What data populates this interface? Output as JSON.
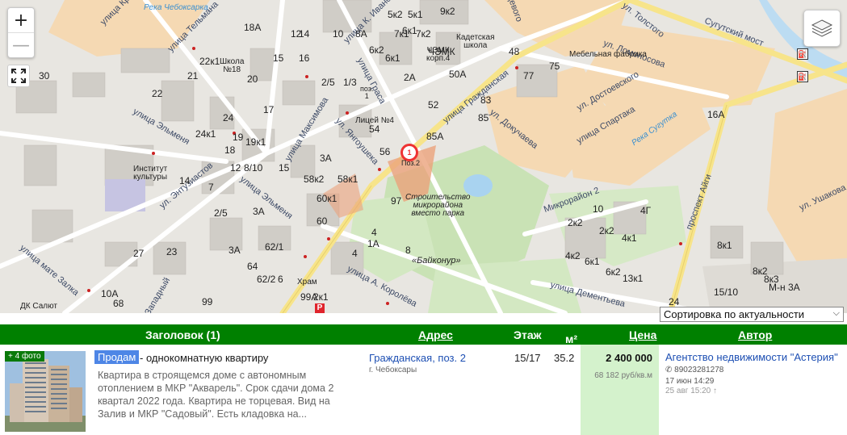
{
  "map": {
    "zoom_in": "+",
    "zoom_out": "—",
    "pin_number": "1",
    "pin_label": "Поз.2",
    "parking": "P",
    "gas": "⛽",
    "streets": {
      "s1": "улица Кр",
      "s2": "улица Тельмана",
      "s3": "улица К. Иванова",
      "s4": "улица Гладкова",
      "s5": "улица Граса",
      "s6": "улица Гражданская",
      "s7": "ул. Толстого",
      "s8": "ул. Ломоносова",
      "s9": "ул. Достоевского",
      "s10": "улица Спартака",
      "s11": "ул. Докучаева",
      "s12": "Сугутский мост",
      "s13": "улица Эльменя",
      "s14": "улица Максимова",
      "s15": "ул. Янгоушека",
      "s16": "ул. Энтузиастов",
      "s17": "улица Эльменя",
      "s18": "улица мате Залка",
      "s19": "Западный",
      "s20": "улица А. Королёва",
      "s21": "улица Дементьева",
      "s22": "Микрорайон 2",
      "s23": "проспект Айги",
      "s24": "ул. Ушакова",
      "s25": "Река Чебоксарка",
      "s26": "Река Сугутка",
      "s27": "щевого"
    },
    "places": {
      "school18": "Школа\n№18",
      "lyceum4": "Лицей №4",
      "cadet": "Кадетская\nшкола",
      "furniture": "Мебельная\nфабрика",
      "chemk": "ЧЭМК\nкорп.4",
      "institute": "Институт\nкультуры",
      "temple": "Храм",
      "salute": "ДК Салют",
      "construction": "Строительство\nмикрорайона\nвместо парка",
      "baikonur": "«Байконур»",
      "pos": "поз.\n1"
    },
    "numbers": [
      "5к2",
      "5к1",
      "9к2",
      "6к1",
      "18А",
      "10",
      "8А",
      "7к1",
      "7к2",
      "12",
      "14",
      "15",
      "16",
      "6к2",
      "6к1",
      "48",
      "75",
      "77",
      "2/5",
      "1/3",
      "ЧЭМК",
      "50А",
      "2А",
      "22к1",
      "21",
      "30",
      "20",
      "24",
      "19",
      "22",
      "17",
      "54",
      "52",
      "83",
      "85",
      "16А",
      "24к1",
      "19к1",
      "18",
      "85А",
      "56",
      "12",
      "8/10",
      "15",
      "3А",
      "58к2",
      "58к1",
      "60к1",
      "97",
      "14",
      "7",
      "2/5",
      "3А",
      "60",
      "4",
      "1А",
      "8",
      "4",
      "3А",
      "64",
      "62/1",
      "62/2",
      "6",
      "23",
      "27",
      "10А",
      "68",
      "99",
      "99А",
      "2к1",
      "2к2",
      "10",
      "4Г",
      "2к2",
      "4к1",
      "4к2",
      "6к1",
      "6к2",
      "13к1",
      "8к1",
      "8к2",
      "8к3",
      "М-н 3А",
      "15/10",
      "24"
    ],
    "sort_selected": "Сортировка по актуальности"
  },
  "table": {
    "headers": {
      "title": "Заголовок (1)",
      "address": "Адрес",
      "floor": "Этаж",
      "area": "м²",
      "price": "Цена",
      "author": "Автор"
    },
    "row": {
      "photo_badge": "+ 4 фото",
      "deal": "Продам",
      "title": "- однокомнатную квартиру",
      "description": "Квартира в строящемся доме с автономным отоплением в МКР \"Акварель\". Срок сдачи дома 2 квартал 2022 года. Квартира не торцевая. Вид на Залив и МКР \"Садовый\". Есть кладовка на...",
      "address": "Гражданская, поз. 2",
      "city": "г. Чебоксары",
      "floor": "15/17",
      "area": "35.2",
      "price": "2 400 000",
      "price_per_m": "68 182 руб/кв.м",
      "agent": "Агентство недвижимости \"Астерия\"",
      "phone": "89023281278",
      "date_posted": "17 июн 14:29",
      "date_updated": "25 авг 15:20 ↑"
    }
  },
  "colors": {
    "header_green": "#008000",
    "deal_blue": "#4e86e6",
    "price_bg": "#d4f2cc",
    "link_blue": "#1d4fb3"
  }
}
